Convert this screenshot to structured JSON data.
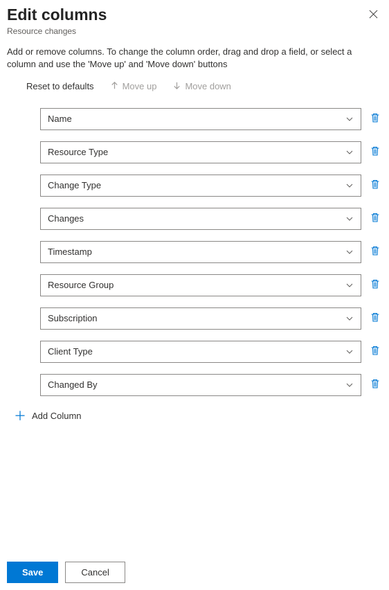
{
  "header": {
    "title": "Edit columns",
    "subtitle": "Resource changes"
  },
  "description": "Add or remove columns. To change the column order, drag and drop a field, or select a column and use the 'Move up' and 'Move down' buttons",
  "toolbar": {
    "reset": "Reset to defaults",
    "moveUp": "Move up",
    "moveDown": "Move down"
  },
  "columns": [
    {
      "label": "Name"
    },
    {
      "label": "Resource Type"
    },
    {
      "label": "Change Type"
    },
    {
      "label": "Changes"
    },
    {
      "label": "Timestamp"
    },
    {
      "label": "Resource Group"
    },
    {
      "label": "Subscription"
    },
    {
      "label": "Client Type"
    },
    {
      "label": "Changed By"
    }
  ],
  "addColumn": "Add Column",
  "footer": {
    "save": "Save",
    "cancel": "Cancel"
  }
}
